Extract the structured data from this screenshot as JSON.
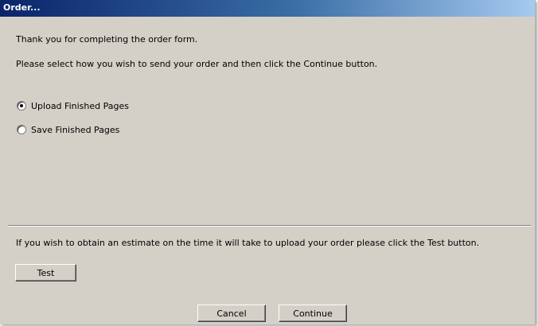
{
  "window": {
    "title": "Order..."
  },
  "dialog": {
    "thank_you_text": "Thank you for completing the order form.",
    "instruction_text": "Please select how you wish to send your order and then click the Continue button.",
    "options": [
      {
        "label": "Upload Finished Pages",
        "checked": true
      },
      {
        "label": "Save Finished Pages",
        "checked": false
      }
    ],
    "estimate_text": "If you wish to obtain an estimate on the time it will take to upload your order please click the Test button."
  },
  "buttons": {
    "test_label": "Test",
    "cancel_label": "Cancel",
    "continue_label": "Continue"
  },
  "colors": {
    "title_gradient_start": "#0a246a",
    "title_gradient_end": "#a6caf0",
    "dialog_background": "#d4d0c8"
  }
}
